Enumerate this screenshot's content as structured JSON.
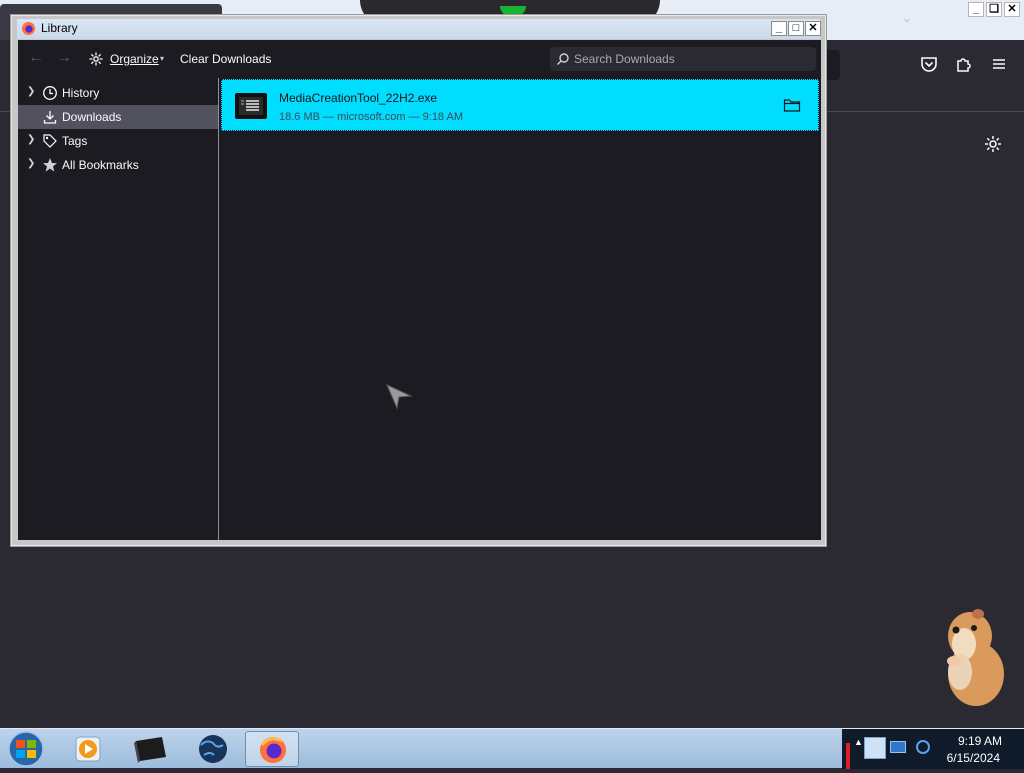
{
  "library": {
    "title": "Library",
    "toolbar": {
      "organize_label": "Organize",
      "clear_label": "Clear Downloads",
      "search_placeholder": "Search Downloads"
    },
    "sidebar": [
      {
        "label": "History",
        "icon": "clock-icon",
        "expandable": true,
        "selected": false
      },
      {
        "label": "Downloads",
        "icon": "download-icon",
        "expandable": false,
        "selected": true
      },
      {
        "label": "Tags",
        "icon": "tag-icon",
        "expandable": true,
        "selected": false
      },
      {
        "label": "All Bookmarks",
        "icon": "star-icon",
        "expandable": true,
        "selected": false
      }
    ],
    "downloads": [
      {
        "name": "MediaCreationTool_22H2.exe",
        "meta": "18.6 MB — microsoft.com — 9:18 AM"
      }
    ]
  },
  "taskbar": {
    "time": "9:19 AM",
    "date": "6/15/2024",
    "apps": [
      "media-player-icon",
      "app-box-icon",
      "globe-icon",
      "firefox-icon"
    ]
  },
  "colors": {
    "selected_row": "#00ddff",
    "window_bg": "#1c1b22",
    "browser_bg": "#2b2a33",
    "sidebar_selected": "#52525e"
  }
}
